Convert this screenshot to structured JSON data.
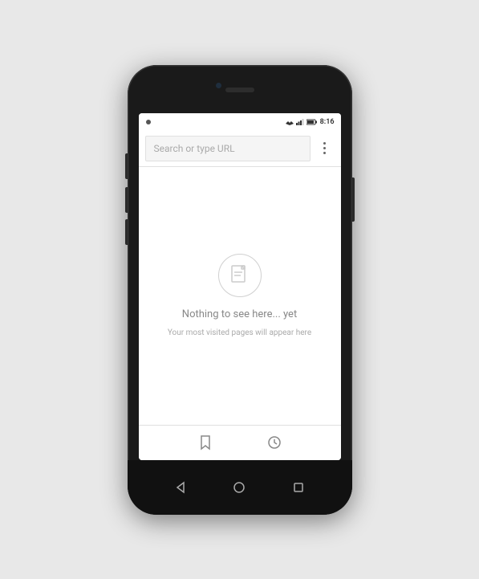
{
  "phone": {
    "status_bar": {
      "time": "8:16",
      "left_icon": "●"
    },
    "url_bar": {
      "placeholder": "Search or type URL",
      "menu_icon": "more-vertical-icon"
    },
    "main": {
      "empty_icon": "document-icon",
      "empty_title": "Nothing to see here... yet",
      "empty_subtitle": "Your most visited pages will appear here"
    },
    "tab_bar": {
      "bookmarks_icon": "bookmarks-icon",
      "history_icon": "history-icon"
    },
    "nav_bar": {
      "back_icon": "back-icon",
      "home_icon": "home-icon",
      "recents_icon": "recents-icon"
    }
  }
}
